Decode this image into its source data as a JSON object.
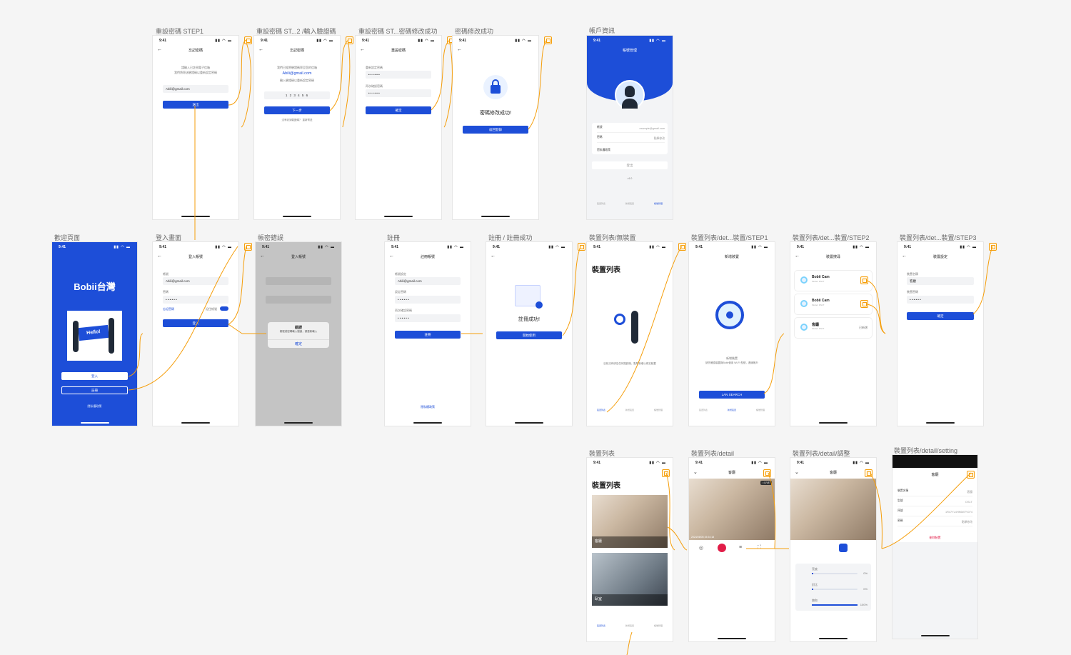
{
  "labels": {
    "reset1": "重設密碼 STEP1",
    "reset2": "重設密碼 ST...2 /輸入驗證碼",
    "reset3": "重設密碼 ST...密碼修改成功",
    "resetok": "密碼修改成功",
    "account": "帳戶資訊",
    "welcome": "歡迎頁面",
    "login": "登入畫面",
    "pwerr": "帳密錯誤",
    "register": "註冊",
    "regok": "註冊 / 註冊成功",
    "devempty": "裝置列表/無裝置",
    "devstep1": "裝置列表/det...裝置/STEP1",
    "devstep2": "裝置列表/det...裝置/STEP2",
    "devstep3": "裝置列表/det...裝置/STEP3",
    "devlist": "裝置列表",
    "devdetail": "裝置列表/detail",
    "devadjust": "裝置列表/detail/調整",
    "devsetting": "裝置列表/detail/setting"
  },
  "common": {
    "time": "9:41",
    "signal": "▮▮ ◠ ▬"
  },
  "reset1": {
    "title": "忘記密碼",
    "hint1": "請輸入已註冊電子信箱",
    "hint2": "我們將寄送驗證碼以重新設定密碼",
    "email": "Abili@gmail.com",
    "btn": "送出"
  },
  "reset2": {
    "title": "忘記密碼",
    "hint1": "我們已經將驗證碼寄至您的信箱",
    "email": "Abili@gmail.com",
    "hint2": "輸入驗證碼以重新設定密碼",
    "code": "1 2 3 4 5 6",
    "btn": "下一步",
    "resend": "沒有收到驗證碼？ 重新寄送"
  },
  "reset3": {
    "title": "重設密碼",
    "l1": "重新設定密碼",
    "l2": "再次確認密碼",
    "pw": "• • • • • •",
    "show": "顯示",
    "btn": "確定"
  },
  "resetok": {
    "msg": "密碼修改成功!",
    "btn": "返回登錄"
  },
  "account": {
    "title": "帳號管理",
    "r1": "帳號",
    "r1v": "example@gmail.com",
    "r2": "密碼",
    "r2v": "點擊修改",
    "r3": "隱私權政策",
    "logout": "登出",
    "ver": "v1.0",
    "tabs": [
      "裝置列表",
      "新增裝置",
      "帳號管理"
    ]
  },
  "welcome": {
    "logo": "Bobii台灣",
    "hello": "Hello!",
    "login": "登入",
    "register": "註冊",
    "privacy": "隱私權政策"
  },
  "login": {
    "title": "登入帳號",
    "l1": "帳號",
    "email": "Abili@gmail.com",
    "l2": "密碼",
    "pw": "• • • • • •",
    "show": "顯示",
    "forgot": "忘記密碼",
    "remember": "記住帳號",
    "btn": "登入"
  },
  "pwerr": {
    "title": "登入帳號",
    "alert_title": "錯誤",
    "alert_msg": "帳號或密碼輸入錯誤，請重新輸入",
    "alert_btn": "確定"
  },
  "register": {
    "title": "註冊帳號",
    "l1": "帳號設定",
    "email": "Abili@gmail.com",
    "l2": "設定密碼",
    "l3": "再次確認密碼",
    "pw": "• • • • • •",
    "btn": "註冊",
    "privacy": "隱私權政策"
  },
  "regok": {
    "msg": "註冊成功!",
    "btn": "開始使用"
  },
  "devempty": {
    "title": "裝置列表",
    "msg": "目前沒有綁定任何攝影機，點擊新增以綁定裝置",
    "tabs": [
      "裝置列表",
      "新增裝置",
      "帳號管理"
    ]
  },
  "devstep1": {
    "title": "新增裝置",
    "msg1": "新增裝置",
    "msg2": "請先確認裝置與Bobii使用 Wi-Fi 型號，連線帳戶",
    "btn": "LAN SEARCH",
    "tabs": [
      "裝置列表",
      "新增裝置",
      "帳號管理"
    ]
  },
  "devstep2": {
    "title": "裝置搜尋",
    "cards": [
      {
        "name": "Bobii Cam",
        "sub": "Model: DS1T"
      },
      {
        "name": "Bobii Cam",
        "sub": "Model: DS1T"
      },
      {
        "name": "客廳",
        "sub": "Model: DS1T"
      }
    ],
    "added": "已新增"
  },
  "devstep3": {
    "title": "裝置設定",
    "l1": "裝置名稱",
    "name": "客廳",
    "l2": "裝置密碼",
    "pw": "• • • • • •",
    "btn": "確定"
  },
  "devlist": {
    "title": "裝置列表",
    "cam1": "客廳",
    "cam2": "臥室",
    "sub": "1R47YL4HN6W7V074",
    "tabs": [
      "裝置列表",
      "新增裝置",
      "帳號管理"
    ]
  },
  "devdetail": {
    "title": "客廳",
    "ts": "2024/06/05 19:24:18",
    "live": "• LIVE"
  },
  "devadjust": {
    "title": "客廳",
    "s1": "亮度",
    "s1v": "0%",
    "s2": "對比",
    "s2v": "0%",
    "s3": "飽和",
    "s3v": "100%"
  },
  "devsetting": {
    "title": "客廳",
    "r1": "裝置名稱",
    "r1v": "客廳",
    "r2": "型號",
    "r2v": "DS1T",
    "r3": "序號",
    "r3v": "1R47YL4HN6W7V074",
    "r4": "密碼",
    "r4v": "點擊修改",
    "del": "刪除裝置"
  },
  "colors": {
    "brand": "#1d4ed8",
    "link": "#f59e0b"
  }
}
